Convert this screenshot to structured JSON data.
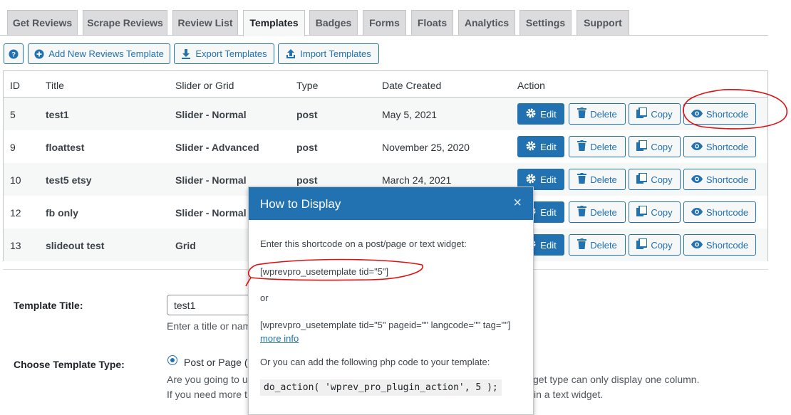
{
  "tabs": [
    {
      "label": "Get Reviews"
    },
    {
      "label": "Scrape Reviews"
    },
    {
      "label": "Review List"
    },
    {
      "label": "Templates"
    },
    {
      "label": "Badges"
    },
    {
      "label": "Forms"
    },
    {
      "label": "Floats"
    },
    {
      "label": "Analytics"
    },
    {
      "label": "Settings"
    },
    {
      "label": "Support"
    }
  ],
  "active_tab": "Templates",
  "toolbar": {
    "help_icon": "question-icon",
    "add_label": "Add New Reviews Template",
    "export_label": "Export Templates",
    "import_label": "Import Templates"
  },
  "table": {
    "headers": {
      "id": "ID",
      "title": "Title",
      "layout": "Slider or Grid",
      "type": "Type",
      "date": "Date Created",
      "action": "Action"
    },
    "rows": [
      {
        "id": "5",
        "title": "test1",
        "layout": "Slider - Normal",
        "type": "post",
        "date": "May 5, 2021"
      },
      {
        "id": "9",
        "title": "floattest",
        "layout": "Slider - Advanced",
        "type": "post",
        "date": "November 25, 2020"
      },
      {
        "id": "10",
        "title": "test5 etsy",
        "layout": "Slider - Normal",
        "type": "post",
        "date": "March 24, 2021"
      },
      {
        "id": "12",
        "title": "fb only",
        "layout": "Slider - Normal",
        "type": "",
        "date": ""
      },
      {
        "id": "13",
        "title": "slideout test",
        "layout": "Grid",
        "type": "",
        "date": ""
      }
    ],
    "actions": {
      "edit": "Edit",
      "delete": "Delete",
      "copy": "Copy",
      "shortcode": "Shortcode"
    }
  },
  "form": {
    "title_label": "Template Title:",
    "title_value": "test1",
    "title_desc": "Enter a title or nam",
    "type_label": "Choose Template Type:",
    "type_option": "Post or Page (S",
    "type_desc_1": "Are you going to u",
    "type_desc_1_end": "get type can only display one column.",
    "type_desc_2": "If you need more t",
    "type_desc_2_end": "in a text widget."
  },
  "modal": {
    "title": "How to Display",
    "close": "×",
    "intro": "Enter this shortcode on a post/page or text widget:",
    "shortcode": "[wprevpro_usetemplate tid=\"5\"]",
    "or": "or",
    "shortcode_full": "[wprevpro_usetemplate tid=\"5\" pageid=\"\" langcode=\"\" tag=\"\"]",
    "more_info": "more info",
    "php_intro": "Or you can add the following php code to your template:",
    "php_code": "do_action( 'wprev_pro_plugin_action', 5 );"
  },
  "colors": {
    "primary": "#2271b1",
    "tab_bg": "#dcdcde",
    "annotation": "#e01010"
  }
}
